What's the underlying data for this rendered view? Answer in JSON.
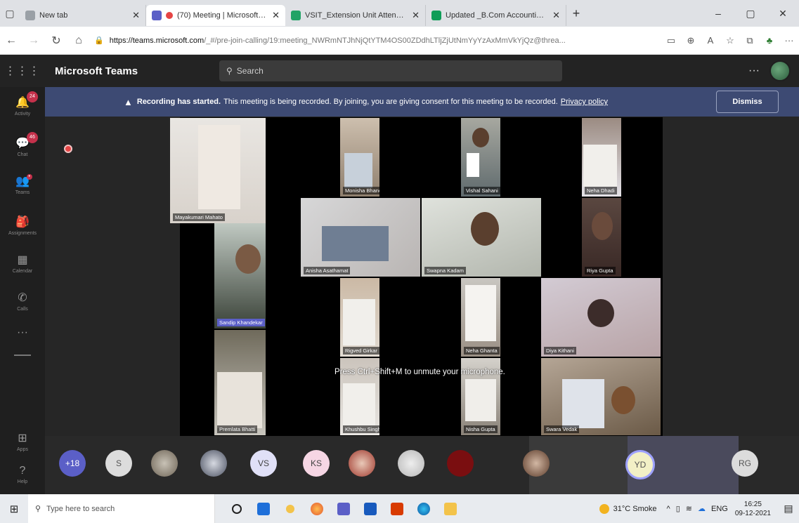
{
  "browser": {
    "tabs": [
      {
        "label": "New tab",
        "active": false,
        "icon_color": "#9aa0a6"
      },
      {
        "label": "(70) Meeting | Microsoft Te",
        "active": true,
        "icon_color": "#5b5fc7"
      },
      {
        "label": "VSIT_Extension Unit Attendance",
        "active": false,
        "icon_color": "#21a366"
      },
      {
        "label": "Updated _B.Com Accounting &",
        "active": false,
        "icon_color": "#0f9d58"
      }
    ],
    "new_tab_symbol": "+",
    "window_controls": [
      "–",
      "▢",
      "✕"
    ],
    "url_host": "https://teams.microsoft.com",
    "url_path": "/_#/pre-join-calling/19:meeting_NWRmNTJhNjQtYTM4OS00ZDdhLTljZjUtNmYyYzAxMmVkYjQz@threa..."
  },
  "teams": {
    "app_title": "Microsoft Teams",
    "search_placeholder": "Search",
    "more_label": "···"
  },
  "rail": [
    {
      "label": "Activity",
      "icon": "bell-icon",
      "badge": "24"
    },
    {
      "label": "Chat",
      "icon": "chat-icon",
      "badge": "46"
    },
    {
      "label": "Teams",
      "icon": "teams-icon",
      "badge": "•"
    },
    {
      "label": "Assignments",
      "icon": "assignments-icon",
      "badge": ""
    },
    {
      "label": "Calendar",
      "icon": "calendar-icon",
      "badge": ""
    },
    {
      "label": "Calls",
      "icon": "phone-icon",
      "badge": ""
    },
    {
      "label": "",
      "icon": "more-icon",
      "badge": ""
    },
    {
      "label": "Apps",
      "icon": "apps-icon",
      "badge": ""
    },
    {
      "label": "Help",
      "icon": "help-icon",
      "badge": ""
    }
  ],
  "banner": {
    "bold": "Recording has started.",
    "text": "This meeting is being recorded. By joining, you are giving consent for this meeting to be recorded.",
    "link": "Privacy policy",
    "dismiss": "Dismiss"
  },
  "participants": [
    "Mayakumari Mahato",
    "Monisha Bhanda",
    "Vishal Sahani",
    "Neha Dhadi",
    "Anisha Asathamat",
    "Swapna Kadam",
    "Riya Gupta",
    "Sandip Khandekar",
    "Rigved Girkar",
    "Neha Ghanta",
    "Diya Kithani",
    "Premlata Bhatti",
    "Khushbu Singh",
    "Nisha Gupta",
    "Swara Vedak"
  ],
  "toast": "Press Ctrl+Shift+M to unmute your microphone.",
  "strip": {
    "overflow": "+18",
    "initials": [
      "S",
      "VS",
      "KS",
      "YD",
      "RG"
    ]
  },
  "taskbar": {
    "search_placeholder": "Type here to search",
    "weather": "31°C  Smoke",
    "lang": "ENG",
    "time": "16:25",
    "date": "09-12-2021"
  }
}
